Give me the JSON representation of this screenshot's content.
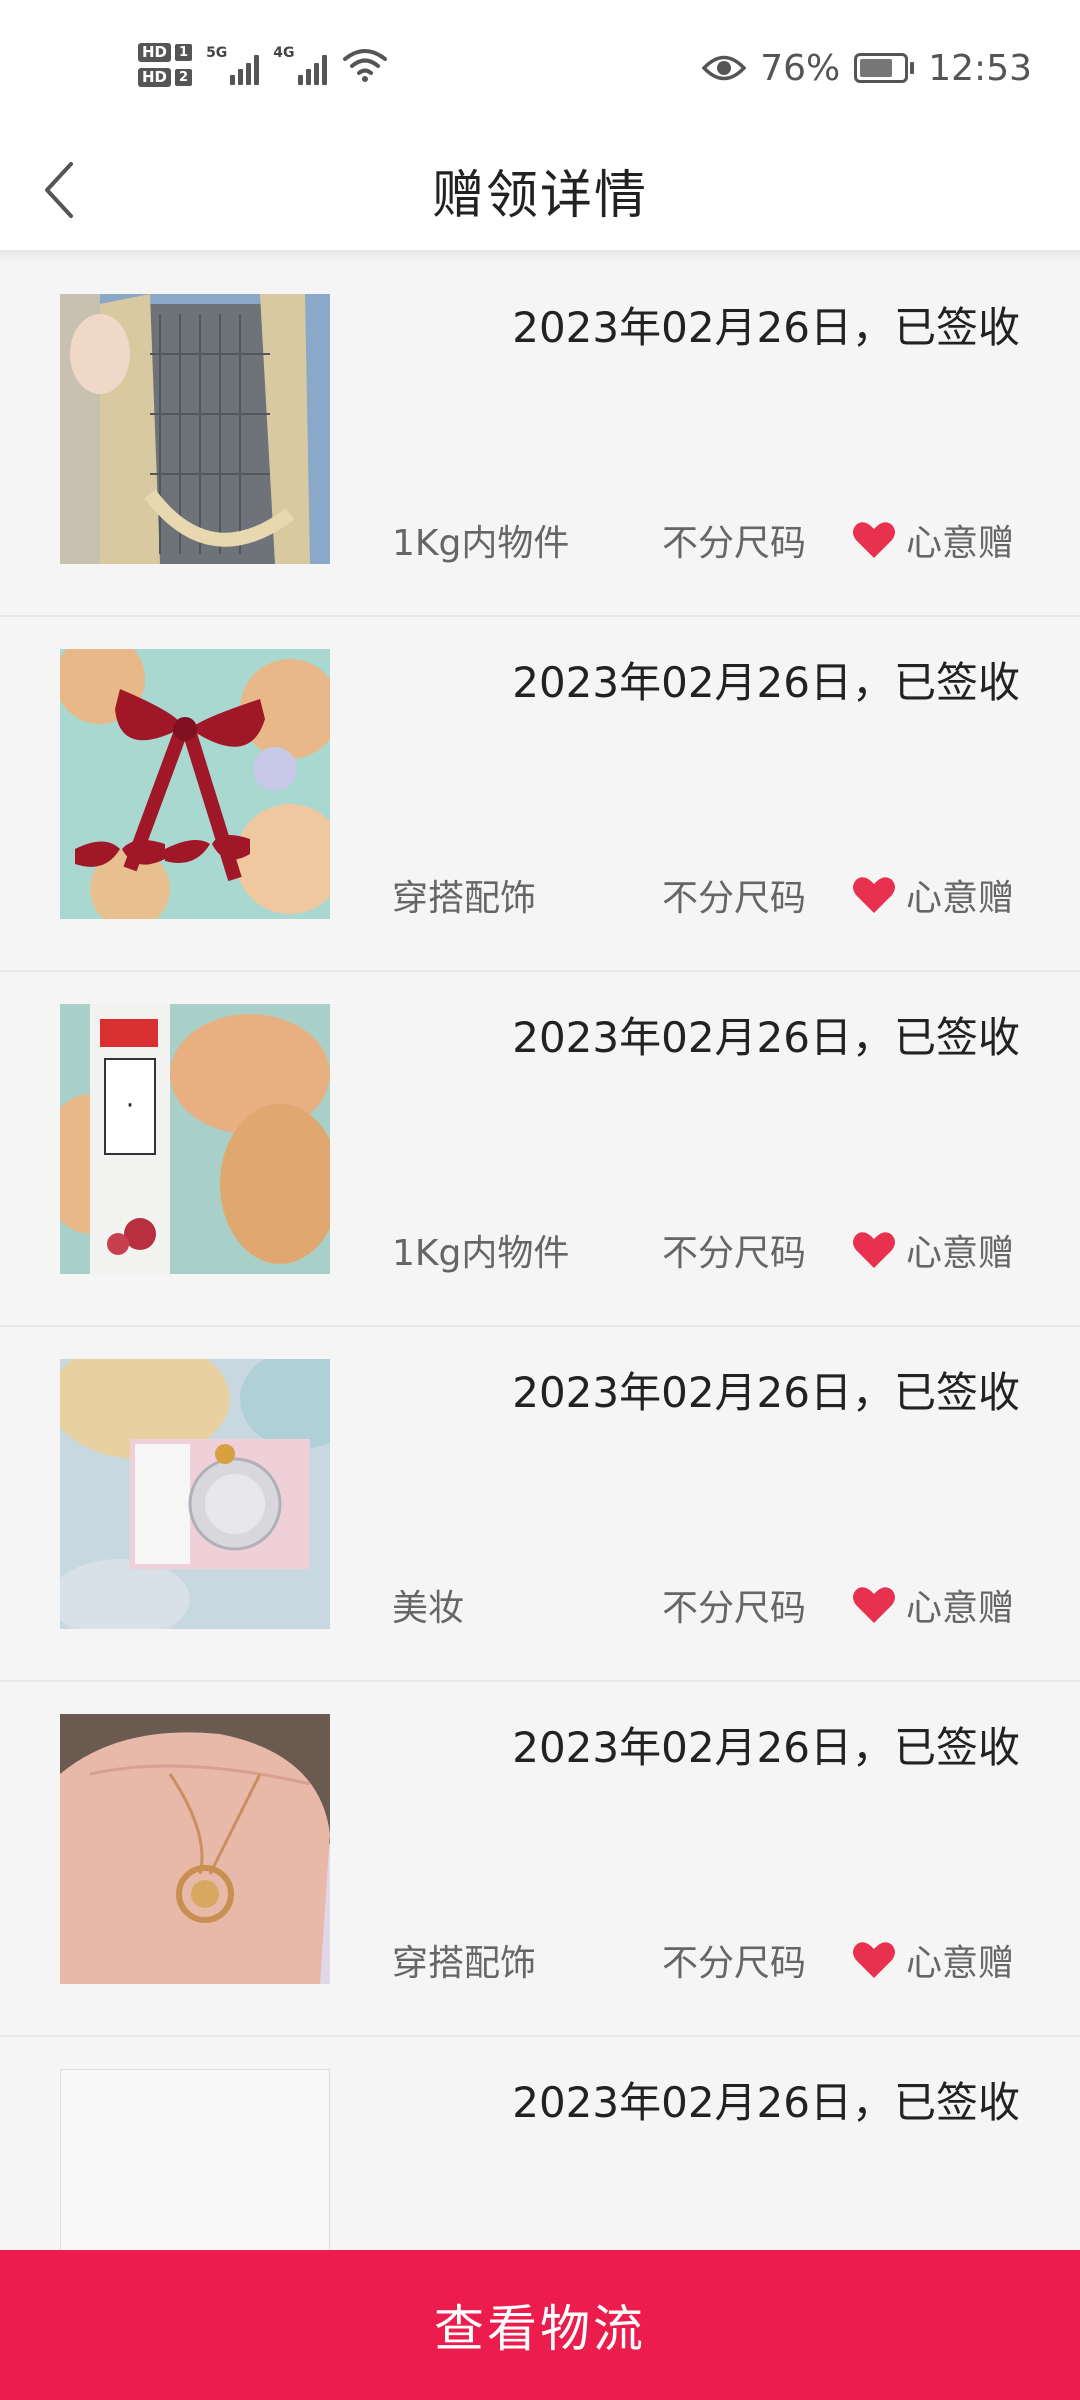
{
  "status_bar": {
    "sim1": "1",
    "sim2": "2",
    "hd": "HD",
    "net1": "5G",
    "net2": "4G",
    "battery_pct": "76%",
    "time": "12:53"
  },
  "header": {
    "title": "赠领详情"
  },
  "items": [
    {
      "date": "2023年02月26日，已签收",
      "category": "1Kg内物件",
      "size": "不分尺码",
      "type": "心意赠",
      "image": "bag-photo"
    },
    {
      "date": "2023年02月26日，已签收",
      "category": "穿搭配饰",
      "size": "不分尺码",
      "type": "心意赠",
      "image": "red-bows-photo"
    },
    {
      "date": "2023年02月26日，已签收",
      "category": "1Kg内物件",
      "size": "不分尺码",
      "type": "心意赠",
      "image": "toothpaste-photo"
    },
    {
      "date": "2023年02月26日，已签收",
      "category": "美妆",
      "size": "不分尺码",
      "type": "心意赠",
      "image": "olay-cream-photo"
    },
    {
      "date": "2023年02月26日，已签收",
      "category": "穿搭配饰",
      "size": "不分尺码",
      "type": "心意赠",
      "image": "necklace-photo"
    },
    {
      "date": "2023年02月26日，已签收",
      "category": "",
      "size": "",
      "type": "",
      "image": "blank-photo"
    }
  ],
  "footer": {
    "button_label": "查看物流"
  },
  "colors": {
    "accent": "#ec1c4c",
    "heart": "#e8304f"
  }
}
